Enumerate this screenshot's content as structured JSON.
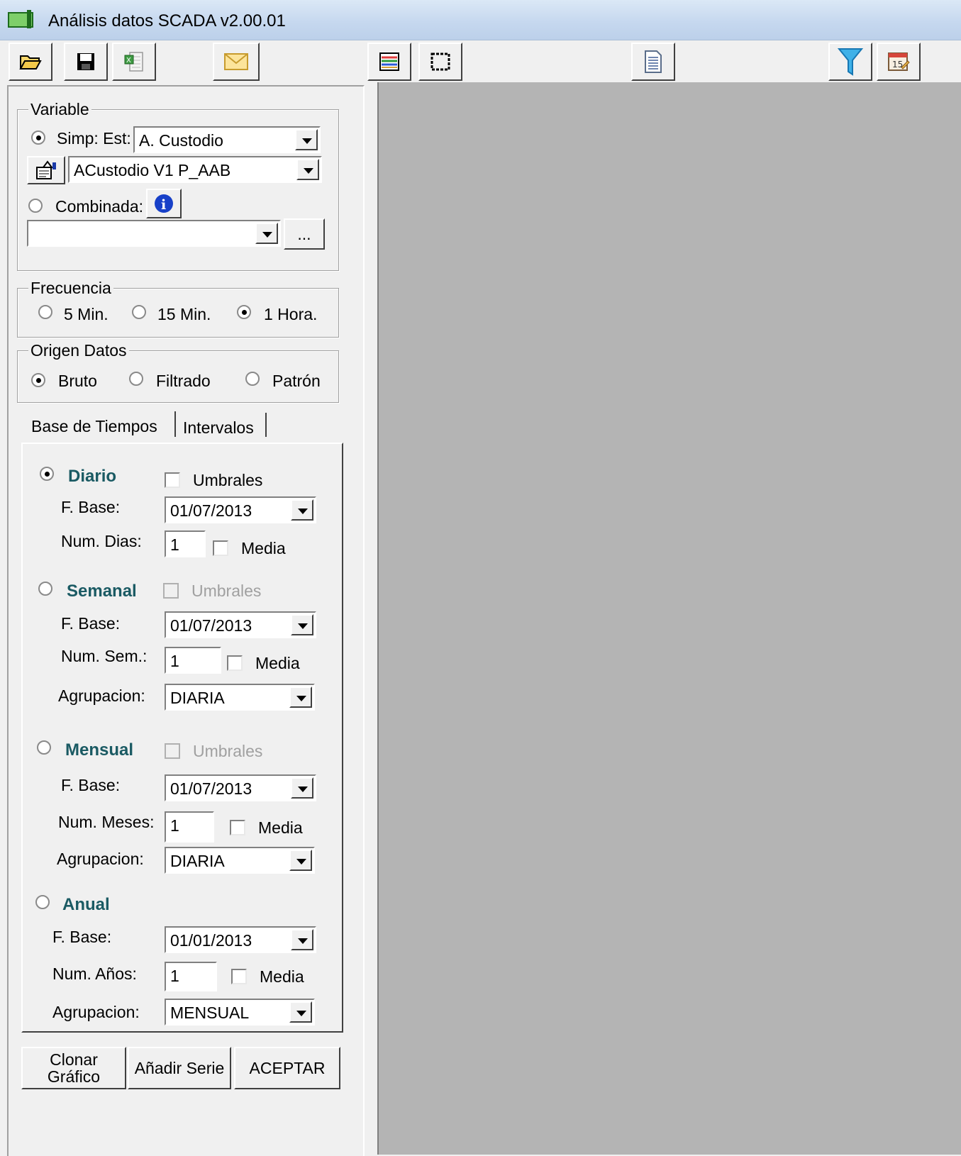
{
  "window": {
    "title": "Análisis datos SCADA v2.00.01"
  },
  "toolbar": {
    "icons": [
      "open-folder-icon",
      "save-disk-icon",
      "excel-export-icon",
      "mail-envelope-icon",
      "chart-series-icon",
      "select-area-icon",
      "report-document-icon",
      "filter-funnel-icon",
      "calendar-icon"
    ]
  },
  "variable": {
    "legend": "Variable",
    "simple_label": "Simp: Est:",
    "station_value": "A. Custodio",
    "signal_value": "ACustodio V1 P_AAB",
    "combined_label": "Combinada:",
    "combined_value": "",
    "browse_label": "...",
    "mode": "simple"
  },
  "frequency": {
    "legend": "Frecuencia",
    "options": [
      "5 Min.",
      "15 Min.",
      "1 Hora."
    ],
    "selected": "1 Hora."
  },
  "origin": {
    "legend": "Origen Datos",
    "options": [
      "Bruto",
      "Filtrado",
      "Patrón"
    ],
    "selected": "Bruto"
  },
  "tabs": [
    "Base de Tiempos",
    "Intervalos"
  ],
  "timebase": {
    "daily": {
      "title": "Diario",
      "thresholds": "Umbrales",
      "base_label": "F. Base:",
      "base_value": "01/07/2013",
      "count_label": "Num. Dias:",
      "count_value": "1",
      "mean_label": "Media"
    },
    "weekly": {
      "title": "Semanal",
      "thresholds": "Umbrales",
      "base_label": "F. Base:",
      "base_value": "01/07/2013",
      "count_label": "Num. Sem.:",
      "count_value": "1",
      "mean_label": "Media",
      "group_label": "Agrupacion:",
      "group_value": "DIARIA"
    },
    "monthly": {
      "title": "Mensual",
      "thresholds": "Umbrales",
      "base_label": "F. Base:",
      "base_value": "01/07/2013",
      "count_label": "Num. Meses:",
      "count_value": "1",
      "mean_label": "Media",
      "group_label": "Agrupacion:",
      "group_value": "DIARIA"
    },
    "yearly": {
      "title": "Anual",
      "base_label": "F. Base:",
      "base_value": "01/01/2013",
      "count_label": "Num. Años:",
      "count_value": "1",
      "mean_label": "Media",
      "group_label": "Agrupacion:",
      "group_value": "MENSUAL"
    },
    "selected": "daily"
  },
  "buttons": {
    "clone_line1": "Clonar",
    "clone_line2": "Gráfico",
    "add_series": "Añadir Serie",
    "accept": "ACEPTAR"
  },
  "colors": {
    "section_header": "#1a5a63",
    "client_area": "#b4b4b4",
    "titlebar": "#c6d8ef"
  }
}
